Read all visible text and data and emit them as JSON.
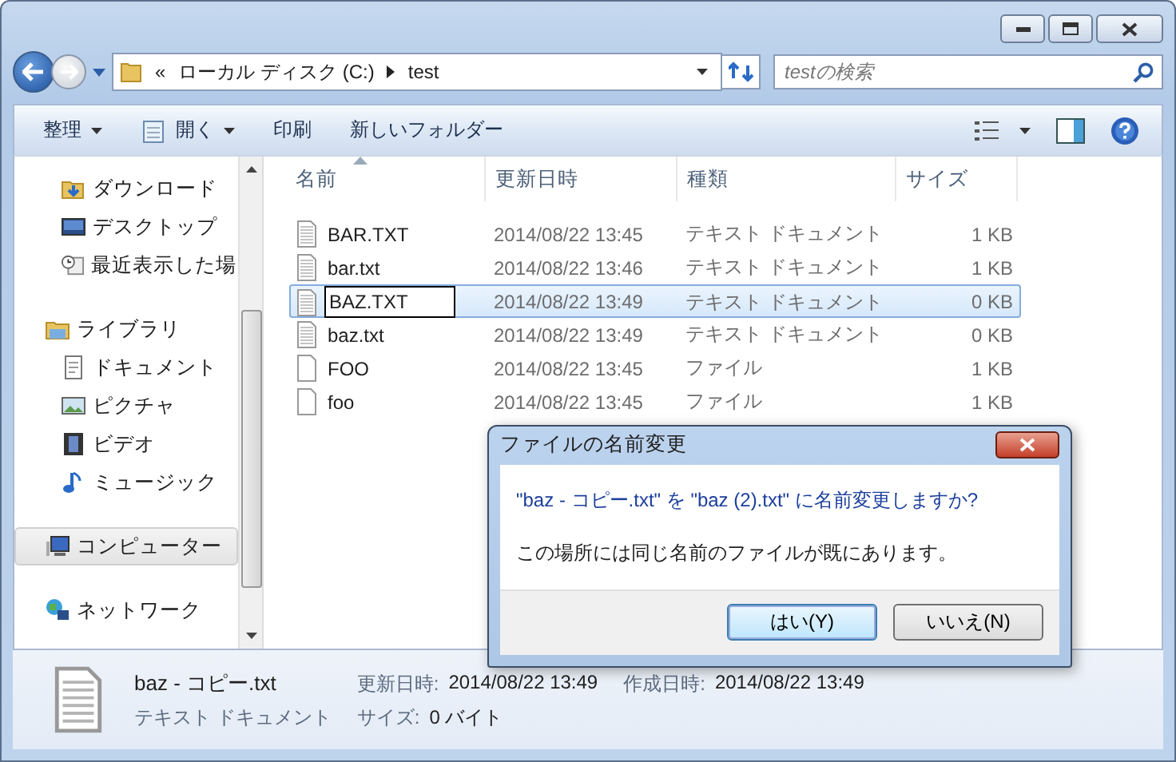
{
  "address": {
    "overflow": "«",
    "crumbs": [
      "ローカル ディスク (C:)",
      "test"
    ]
  },
  "search": {
    "placeholder": "testの検索"
  },
  "toolbar": [
    {
      "label": "整理",
      "dropdown": true
    },
    {
      "label": "開く",
      "dropdown": true,
      "kind": "open"
    },
    {
      "label": "印刷",
      "dropdown": false
    },
    {
      "label": "新しいフォルダー",
      "dropdown": false
    }
  ],
  "nav_tree": [
    {
      "children": [
        {
          "label": "ダウンロード",
          "kind": "download",
          "selected": false
        },
        {
          "label": "デスクトップ",
          "kind": "desktop",
          "selected": false
        },
        {
          "label": "最近表示した場",
          "kind": "recent",
          "selected": false
        }
      ]
    },
    {
      "label": "ライブラリ",
      "kind": "library",
      "selected": false,
      "children": [
        {
          "label": "ドキュメント",
          "kind": "document",
          "selected": false
        },
        {
          "label": "ピクチャ",
          "kind": "picture",
          "selected": false
        },
        {
          "label": "ビデオ",
          "kind": "video",
          "selected": false
        },
        {
          "label": "ミュージック",
          "kind": "music",
          "selected": false
        }
      ]
    },
    {
      "label": "コンピューター",
      "kind": "computer",
      "selected": true
    },
    {
      "label": "ネットワーク",
      "kind": "network",
      "selected": false
    }
  ],
  "table": {
    "columns": [
      "名前",
      "更新日時",
      "種類",
      "サイズ"
    ],
    "rows": [
      {
        "name": "BAR.TXT",
        "modified": "2014/08/22 13:45",
        "type": "テキスト ドキュメント",
        "size": "1 KB",
        "kind": "text",
        "selected": false,
        "editing": false
      },
      {
        "name": "bar.txt",
        "modified": "2014/08/22 13:46",
        "type": "テキスト ドキュメント",
        "size": "1 KB",
        "kind": "text",
        "selected": false,
        "editing": false
      },
      {
        "name": "BAZ.TXT",
        "modified": "2014/08/22 13:49",
        "type": "テキスト ドキュメント",
        "size": "0 KB",
        "kind": "text",
        "selected": true,
        "editing": true
      },
      {
        "name": "baz.txt",
        "modified": "2014/08/22 13:49",
        "type": "テキスト ドキュメント",
        "size": "0 KB",
        "kind": "text",
        "selected": false,
        "editing": false
      },
      {
        "name": "FOO",
        "modified": "2014/08/22 13:45",
        "type": "ファイル",
        "size": "1 KB",
        "kind": "plain",
        "selected": false,
        "editing": false
      },
      {
        "name": "foo",
        "modified": "2014/08/22 13:45",
        "type": "ファイル",
        "size": "1 KB",
        "kind": "plain",
        "selected": false,
        "editing": false
      }
    ]
  },
  "status_bar": {
    "name": "baz - コピー.txt",
    "type": "テキスト ドキュメント",
    "fields": [
      {
        "label": "更新日時:",
        "value": "2014/08/22 13:49"
      },
      {
        "label": "作成日時:",
        "value": "2014/08/22 13:49"
      },
      {
        "label": "サイズ:",
        "value": "0 バイト"
      }
    ]
  },
  "dialog": {
    "title": "ファイルの名前変更",
    "question": "\"baz - コピー.txt\" を \"baz (2).txt\" に名前変更しますか?",
    "message": "この場所には同じ名前のファイルが既にあります。",
    "buttons": [
      {
        "label": "はい(Y)",
        "default": true
      },
      {
        "label": "いいえ(N)",
        "default": false
      }
    ]
  }
}
